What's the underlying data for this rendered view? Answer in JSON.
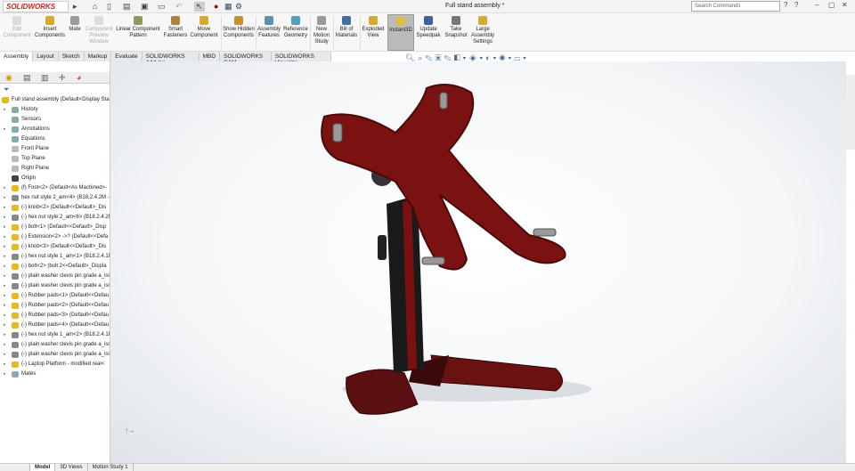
{
  "app": {
    "logo": "SOLIDWORKS",
    "document_title": "Full stand assembly *",
    "search_placeholder": "Search Commands"
  },
  "ribbon": [
    {
      "label": "Edit Component",
      "disabled": true
    },
    {
      "label": "Insert Components"
    },
    {
      "label": "Mate"
    },
    {
      "label": "Component Preview Window",
      "disabled": true
    },
    {
      "label": "Linear Component Pattern"
    },
    {
      "label": "Smart Fasteners"
    },
    {
      "label": "Move Component"
    },
    {
      "label": "Show Hidden Components"
    },
    {
      "label": "Assembly Features"
    },
    {
      "label": "Reference Geometry"
    },
    {
      "label": "New Motion Study"
    },
    {
      "label": "Bill of Materials"
    },
    {
      "label": "Exploded View"
    },
    {
      "label": "Instant3D",
      "active": true
    },
    {
      "label": "Update Speedpak"
    },
    {
      "label": "Take Snapshot"
    },
    {
      "label": "Large Assembly Settings"
    }
  ],
  "tabs": [
    "Assembly",
    "Layout",
    "Sketch",
    "Markup",
    "Evaluate",
    "SOLIDWORKS Add-Ins",
    "MBD",
    "SOLIDWORKS CAM",
    "SOLIDWORKS Visualize"
  ],
  "tree": [
    {
      "label": "Full stand assembly  (Default<Display Sta",
      "type": "asm",
      "arrow": false
    },
    {
      "label": "History",
      "type": "folder",
      "arrow": true
    },
    {
      "label": "Sensors",
      "type": "folder",
      "arrow": false
    },
    {
      "label": "Annotations",
      "type": "folder",
      "arrow": true
    },
    {
      "label": "Equations",
      "type": "folder",
      "arrow": false
    },
    {
      "label": "Front Plane",
      "type": "plane",
      "arrow": false
    },
    {
      "label": "Top Plane",
      "type": "plane",
      "arrow": false
    },
    {
      "label": "Right Plane",
      "type": "plane",
      "arrow": false
    },
    {
      "label": "Origin",
      "type": "origin",
      "arrow": false
    },
    {
      "label": "(f) Foot<2> (Default<As Machined>-",
      "type": "part",
      "arrow": true
    },
    {
      "label": "hex nut style 2_am<4> (B18.2.4.2M -",
      "type": "nut",
      "arrow": true
    },
    {
      "label": "(-) knob<2> (Default<<Default>_Dis",
      "type": "part",
      "arrow": true
    },
    {
      "label": "(-) hex nut style 2_am<6> (B18.2.4.2M",
      "type": "nut",
      "arrow": true
    },
    {
      "label": "(-) bolt<1> (Default<<Default>_Disp",
      "type": "part",
      "arrow": true
    },
    {
      "label": "(-) Extension<2> ->? (Default<<Defa",
      "type": "part",
      "arrow": true
    },
    {
      "label": "(-) knob<3> (Default<<Default>_Dis",
      "type": "part",
      "arrow": true
    },
    {
      "label": "(-) hex nut style 1_am<1> (B18.2.4.1M",
      "type": "nut",
      "arrow": true
    },
    {
      "label": "(-) bolt<2> (bolt 2<<Default>_Displa",
      "type": "part",
      "arrow": true
    },
    {
      "label": "(-) plain washer clevis pin grade a_isc",
      "type": "nut",
      "arrow": true
    },
    {
      "label": "(-) plain washer clevis pin grade a_isc",
      "type": "nut",
      "arrow": true
    },
    {
      "label": "(-) Rubber pads<1> (Default<<Defau",
      "type": "part",
      "arrow": true
    },
    {
      "label": "(-) Rubber pads<2> (Default<<Defau",
      "type": "part",
      "arrow": true
    },
    {
      "label": "(-) Rubber pads<3> (Default<<Defau",
      "type": "part",
      "arrow": true
    },
    {
      "label": "(-) Rubber pads<4> (Default<<Defau",
      "type": "part",
      "arrow": true
    },
    {
      "label": "(-) hex nut style 1_am<2> (B18.2.4.1M",
      "type": "nut",
      "arrow": true
    },
    {
      "label": "(-) plain washer clevis pin grade a_isc",
      "type": "nut",
      "arrow": true
    },
    {
      "label": "(-) plain washer clevis pin grade a_isc",
      "type": "nut",
      "arrow": true
    },
    {
      "label": "(-) Laptop Platform - modified real<",
      "type": "part",
      "arrow": true
    },
    {
      "label": "Mates",
      "type": "mates",
      "arrow": true
    }
  ],
  "bottom_tabs": [
    "Model",
    "3D Views",
    "Motion Study 1"
  ],
  "colors": {
    "part": "#e8b820",
    "model_red": "#7a1010",
    "accent": "#d02020"
  }
}
